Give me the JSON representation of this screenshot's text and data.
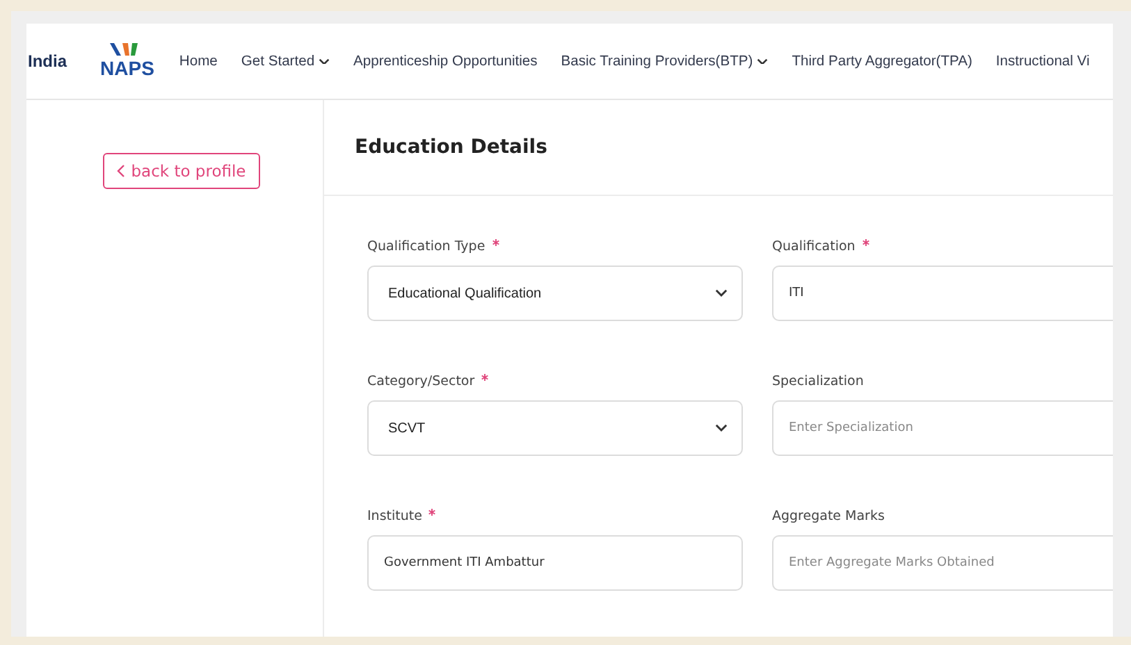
{
  "header": {
    "logos": [
      {
        "kind": "india",
        "text": "India"
      },
      {
        "kind": "naps",
        "text": "NAPS"
      }
    ],
    "nav": [
      {
        "label": "Home",
        "dropdown": false
      },
      {
        "label": "Get Started",
        "dropdown": true
      },
      {
        "label": "Apprenticeship Opportunities",
        "dropdown": false
      },
      {
        "label": "Basic Training Providers(BTP)",
        "dropdown": true
      },
      {
        "label": "Third Party Aggregator(TPA)",
        "dropdown": false
      },
      {
        "label": "Instructional Vi",
        "dropdown": false
      }
    ]
  },
  "sidebar": {
    "back_button": "back to profile"
  },
  "section": {
    "title": "Education Details",
    "fields": [
      {
        "label": "Qualification Type",
        "required": true,
        "kind": "select",
        "value": "Educational Qualification"
      },
      {
        "label": "Qualification",
        "required": true,
        "kind": "input",
        "value": "ITI"
      },
      {
        "label": "Category/Sector",
        "required": true,
        "kind": "select",
        "value": "SCVT"
      },
      {
        "label": "Specialization",
        "required": false,
        "kind": "input",
        "placeholder": "Enter Specialization"
      },
      {
        "label": "Institute",
        "required": true,
        "kind": "input",
        "value": "Government ITI Ambattur"
      },
      {
        "label": "Aggregate Marks",
        "required": false,
        "kind": "input",
        "placeholder": "Enter Aggregate Marks Obtained"
      }
    ]
  }
}
